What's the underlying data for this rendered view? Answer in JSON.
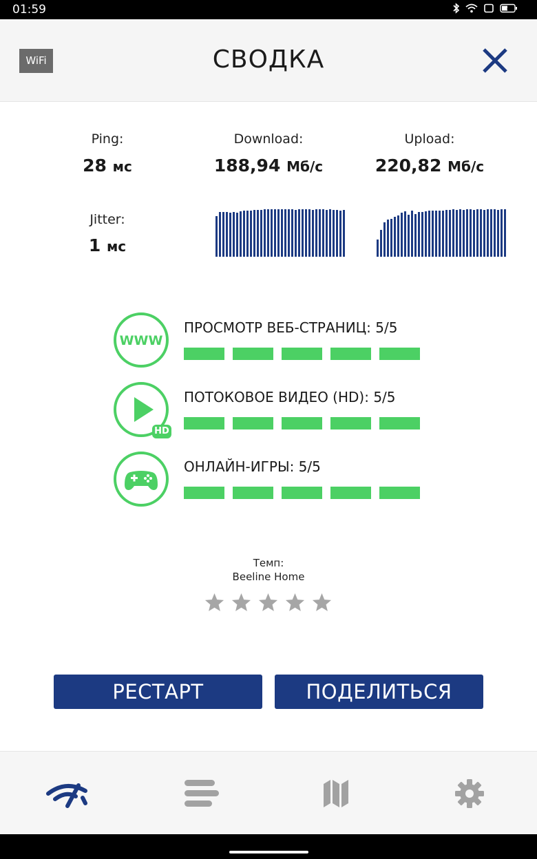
{
  "status_bar": {
    "time": "01:59",
    "battery": "41",
    "icons": [
      "bluetooth-icon",
      "wifi-signal-icon",
      "screen-rotate-icon",
      "battery-icon"
    ]
  },
  "header": {
    "wifi_badge": "WiFi",
    "title": "СВОДКА",
    "close_icon": "close-icon",
    "accent_color": "#1c3a82"
  },
  "metrics": {
    "ping": {
      "label": "Ping:",
      "value": "28",
      "unit": "мс"
    },
    "download": {
      "label": "Download:",
      "value": "188,94",
      "unit": "Мб/с"
    },
    "upload": {
      "label": "Upload:",
      "value": "220,82",
      "unit": "Мб/с"
    },
    "jitter": {
      "label": "Jitter:",
      "value": "1",
      "unit": "мс"
    }
  },
  "download_graph": [
    0.84,
    0.93,
    0.93,
    0.93,
    0.92,
    0.93,
    0.92,
    0.94,
    0.95,
    0.96,
    0.96,
    0.97,
    0.97,
    0.97,
    0.98,
    0.98,
    0.98,
    0.98,
    0.98,
    0.98,
    0.98,
    0.98,
    0.98,
    0.97,
    0.98,
    0.98,
    0.98,
    0.98,
    0.97,
    0.98,
    0.98,
    0.98,
    0.97,
    0.98,
    0.97,
    0.97,
    0.96,
    0.97
  ],
  "upload_graph": [
    0.36,
    0.56,
    0.71,
    0.77,
    0.78,
    0.83,
    0.86,
    0.91,
    0.94,
    0.87,
    0.95,
    0.88,
    0.93,
    0.93,
    0.94,
    0.95,
    0.95,
    0.96,
    0.96,
    0.96,
    0.97,
    0.97,
    0.98,
    0.97,
    0.98,
    0.97,
    0.98,
    0.98,
    0.97,
    0.98,
    0.98,
    0.97,
    0.98,
    0.98,
    0.98,
    0.97,
    0.98,
    0.98
  ],
  "ratings": [
    {
      "icon": "www-icon",
      "icon_text": "WWW",
      "label": "ПРОСМОТР ВЕБ-СТРАНИЦ: 5/5",
      "score": 5,
      "max": 5
    },
    {
      "icon": "play-hd-icon",
      "icon_text": "HD",
      "label": "ПОТОКОВОЕ ВИДЕО (HD): 5/5",
      "score": 5,
      "max": 5
    },
    {
      "icon": "gamepad-icon",
      "icon_text": "",
      "label": "ОНЛАЙН-ИГРЫ: 5/5",
      "score": 5,
      "max": 5
    }
  ],
  "rating_color": "#4cd064",
  "tempo": {
    "label": "Темп:",
    "provider": "Beeline Home",
    "stars_filled": 0,
    "stars_total": 5
  },
  "buttons": {
    "restart": "РЕСТАРТ",
    "share": "ПОДЕЛИТЬСЯ"
  },
  "bottom_nav": [
    {
      "icon": "speedometer-icon",
      "active": true
    },
    {
      "icon": "list-icon",
      "active": false
    },
    {
      "icon": "map-icon",
      "active": false
    },
    {
      "icon": "gear-icon",
      "active": false
    }
  ]
}
